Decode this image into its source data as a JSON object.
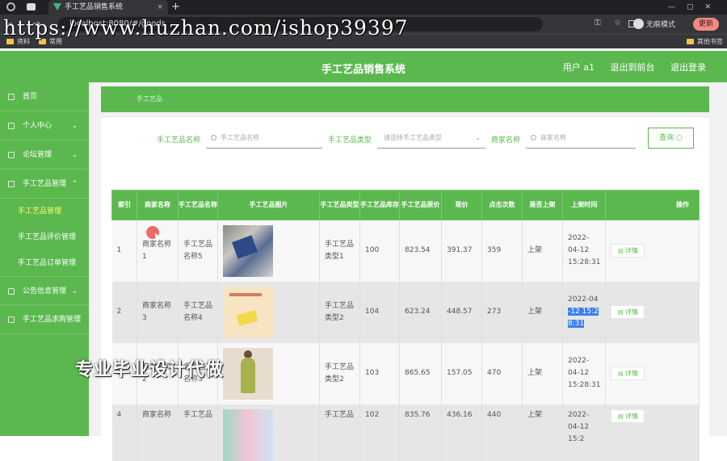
{
  "browser": {
    "tab_title": "手工艺品销售系统",
    "url": "localhost:8080/#/goods",
    "incognito_label": "无痕模式",
    "update_label": "更新",
    "bookmarks": [
      "资料",
      "常用"
    ],
    "other_bookmarks": "其他书签",
    "new_tab": "+",
    "nav_icons": "← → C"
  },
  "watermark": "https://www.huzhan.com/ishop39397",
  "header": {
    "title": "手工艺品销售系统",
    "user": "用户 a1",
    "back_to_front": "退出到前台",
    "logout": "退出登录"
  },
  "sidebar": {
    "items": [
      {
        "label": "首页",
        "has_chevron": false
      },
      {
        "label": "个人中心",
        "has_chevron": true,
        "chevron": "⌄"
      },
      {
        "label": "论坛管理",
        "has_chevron": true,
        "chevron": "⌄"
      },
      {
        "label": "手工艺品管理",
        "has_chevron": true,
        "chevron": "⌃"
      }
    ],
    "sub_items": [
      "手工艺品管理",
      "手工艺品评价管理",
      "手工艺品订单管理"
    ],
    "items_after": [
      {
        "label": "公告信息管理",
        "chevron": "⌄"
      },
      {
        "label": "手工艺品求购管理",
        "chevron": ""
      }
    ]
  },
  "breadcrumb": "手工艺品",
  "filters": {
    "name_label": "手工艺品名称",
    "name_placeholder": "手工艺品名称",
    "type_label": "手工艺品类型",
    "type_placeholder": "请选择手工艺品类型",
    "merchant_label": "商家名称",
    "merchant_placeholder": "商家名称",
    "query_button": "查询"
  },
  "table": {
    "headers": [
      "索引",
      "商家名称",
      "手工艺品名称",
      "手工艺品图片",
      "手工艺品类型",
      "手工艺品库存",
      "手工艺品原价",
      "现价",
      "点击次数",
      "是否上架",
      "上架时间",
      "操作"
    ],
    "detail_label": "详情",
    "rows": [
      {
        "index": "1",
        "merchant": "商家名称1",
        "name": "手工艺品名称5",
        "type": "手工艺品类型1",
        "stock": "100",
        "price": "823.54",
        "now": "391.37",
        "clicks": "359",
        "on": "上架",
        "time": "2022-04-12 15:28:31"
      },
      {
        "index": "2",
        "merchant": "商家名称3",
        "name": "手工艺品名称4",
        "type": "手工艺品类型2",
        "stock": "104",
        "price": "623.24",
        "now": "448.57",
        "clicks": "273",
        "on": "上架",
        "time_a": "2022-04",
        "time_b": "-12 15:2",
        "time_c": "8:31"
      },
      {
        "index": "3",
        "merchant": "商家名称2",
        "name": "手工艺品名称3",
        "type": "手工艺品类型2",
        "stock": "103",
        "price": "865.65",
        "now": "157.05",
        "clicks": "470",
        "on": "上架",
        "time": "2022-04-12 15:28:31"
      },
      {
        "index": "4",
        "merchant": "商家名称",
        "name": "手工艺品",
        "type": "手工艺品",
        "stock": "102",
        "price": "835.76",
        "now": "436.16",
        "clicks": "440",
        "on": "上架",
        "time": "2022-04-12 15:2"
      }
    ]
  },
  "overlay_text": "专业毕业设计代做"
}
